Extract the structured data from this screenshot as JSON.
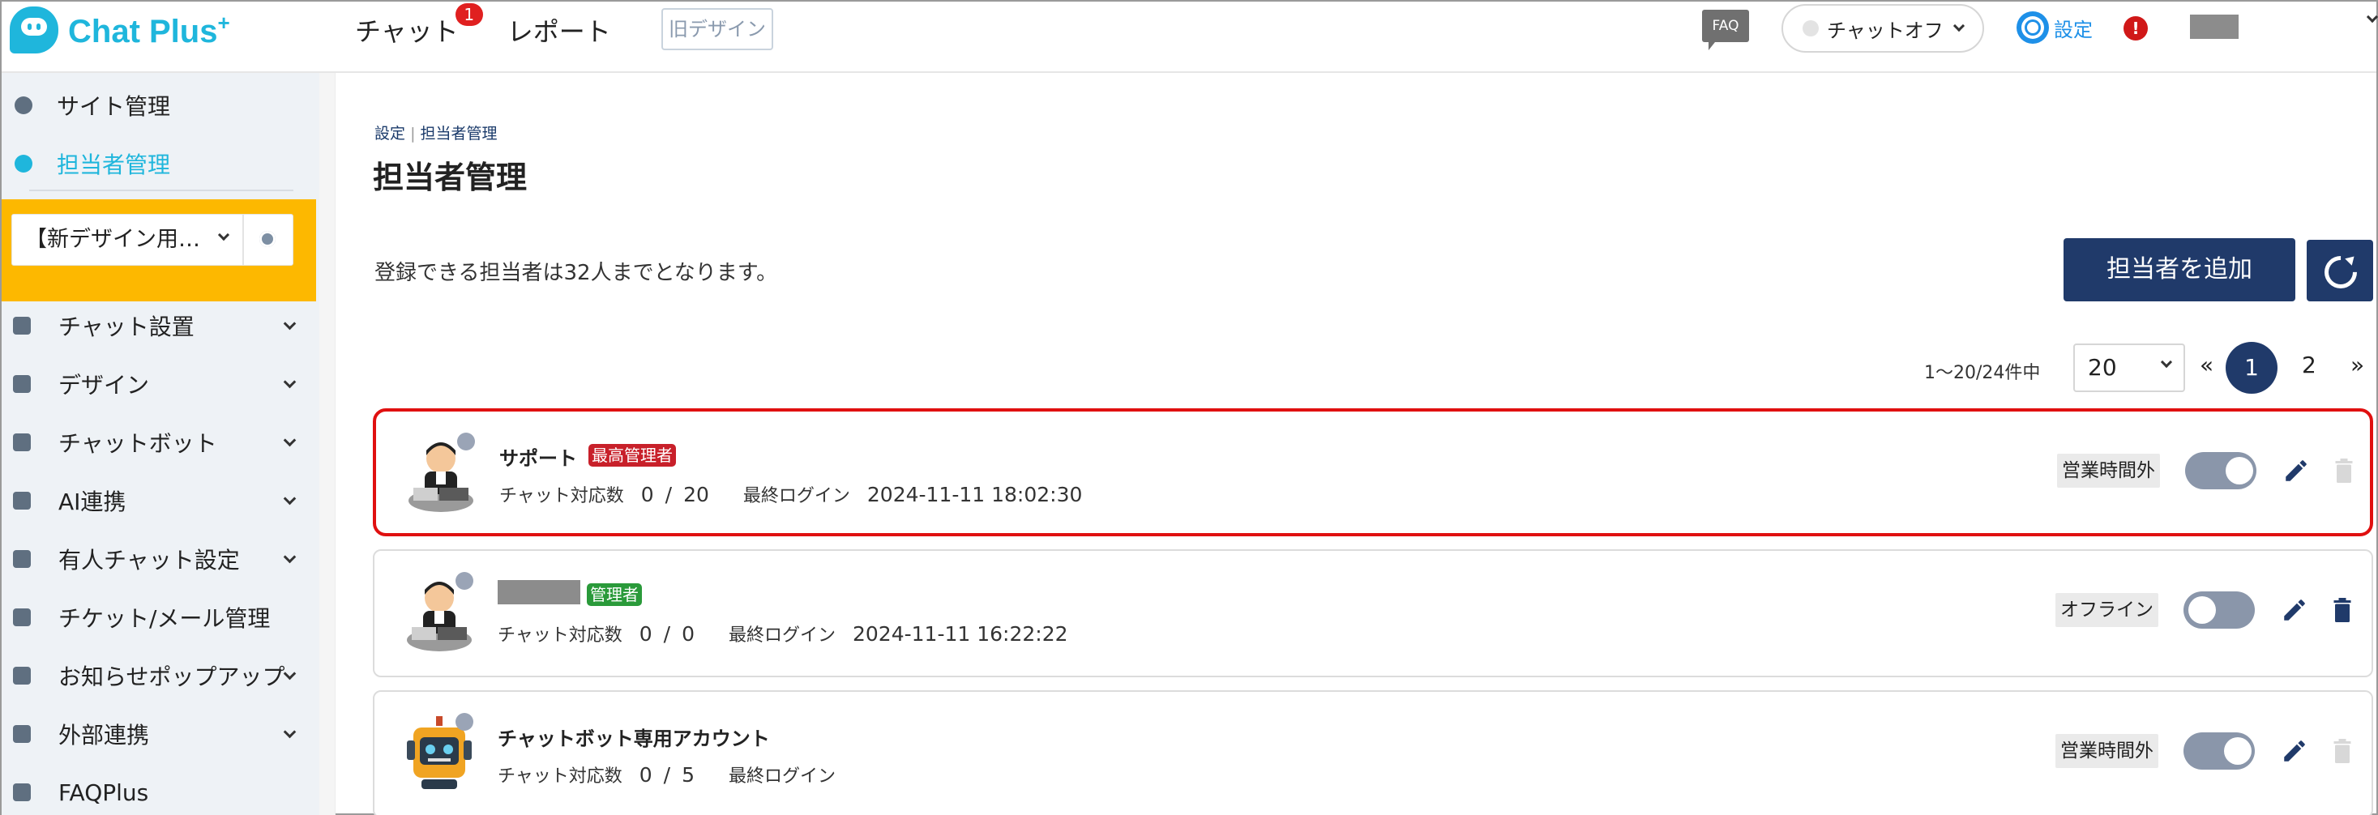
{
  "header": {
    "logo_text": "Chat Plus",
    "logo_plus": "+",
    "nav": [
      {
        "label": "チャット",
        "badge": "1"
      },
      {
        "label": "レポート"
      }
    ],
    "old_design_label": "旧デザイン",
    "faq_label": "FAQ",
    "chat_status_label": "チャットオフ",
    "settings_label": "設定",
    "alert_label": "!"
  },
  "sidebar": {
    "top_items": [
      {
        "label": "サイト管理",
        "icon": "gear-icon"
      },
      {
        "label": "担当者管理",
        "icon": "users-icon",
        "active": true
      }
    ],
    "site_select_value": "【新デザイン用…",
    "menu": [
      {
        "label": "チャット設置",
        "icon": "tools-icon"
      },
      {
        "label": "デザイン",
        "icon": "palette-icon"
      },
      {
        "label": "チャットボット",
        "icon": "chat-bubbles-icon"
      },
      {
        "label": "AI連携",
        "icon": "ai-icon"
      },
      {
        "label": "有人チャット設定",
        "icon": "headset-icon"
      },
      {
        "label": "チケット/メール管理",
        "icon": "ticket-icon"
      },
      {
        "label": "お知らせポップアップ",
        "icon": "popup-icon"
      },
      {
        "label": "外部連携",
        "icon": "share-icon"
      },
      {
        "label": "FAQPlus",
        "icon": "faqplus-icon"
      }
    ]
  },
  "main": {
    "breadcrumb_parent": "設定",
    "breadcrumb_separator": "|",
    "breadcrumb_current": "担当者管理",
    "title": "担当者管理",
    "limit_text": "登録できる担当者は32人までとなります。",
    "add_button_label": "担当者を追加",
    "pagination": {
      "range": "1〜20/24件中",
      "page_size": "20",
      "prev": "«",
      "current": "1",
      "next_page": "2",
      "next": "»"
    },
    "chat_count_label": "チャット対応数",
    "last_login_label": "最終ログイン",
    "operators": [
      {
        "name": "サポート",
        "role": "最高管理者",
        "chats": "0",
        "max": "20",
        "last_login": "2024-11-11 18:02:30",
        "state": "営業時間外",
        "toggle_on": true,
        "selected": true,
        "avatar": "operator-avatar"
      },
      {
        "name": "",
        "role": "管理者",
        "chats": "0",
        "max": "0",
        "last_login": "2024-11-11 16:22:22",
        "state": "オフライン",
        "toggle_on": false,
        "selected": false,
        "avatar": "operator-avatar"
      },
      {
        "name": "チャットボット専用アカウント",
        "role": "",
        "chats": "0",
        "max": "5",
        "last_login": "",
        "state": "営業時間外",
        "toggle_on": true,
        "selected": false,
        "avatar": "robot-avatar"
      }
    ]
  },
  "colors": {
    "brand": "#1fb6dc",
    "primary_button": "#203a6a",
    "site_select_bg": "#fdb800",
    "super_admin_badge": "#c8202a",
    "admin_badge": "#2a9a3a",
    "selection_border": "#e01010"
  }
}
